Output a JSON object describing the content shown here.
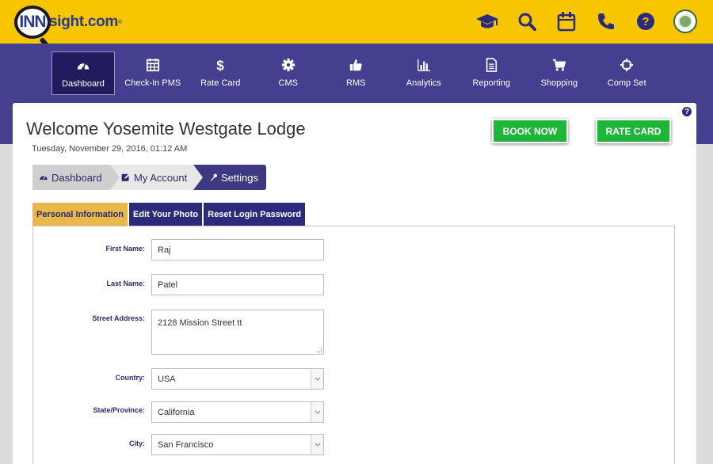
{
  "header": {
    "logo_inn": "INN",
    "logo_text": "sight.com",
    "logo_tm": "®",
    "icons": [
      "graduation-cap-icon",
      "search-icon",
      "calendar-icon",
      "phone-icon",
      "help-icon",
      "avatar"
    ]
  },
  "nav": {
    "items": [
      {
        "label": "Dashboard",
        "icon": "dashboard-icon",
        "active": true
      },
      {
        "label": "Check-In PMS",
        "icon": "calendar-grid-icon"
      },
      {
        "label": "Rate Card",
        "icon": "dollar-icon"
      },
      {
        "label": "CMS",
        "icon": "gear-icon"
      },
      {
        "label": "RMS",
        "icon": "thumbs-up-icon"
      },
      {
        "label": "Analytics",
        "icon": "bar-chart-icon"
      },
      {
        "label": "Reporting",
        "icon": "document-icon"
      },
      {
        "label": "Shopping",
        "icon": "cart-icon"
      },
      {
        "label": "Comp Set",
        "icon": "crosshair-icon"
      }
    ]
  },
  "page": {
    "help_badge": "?",
    "welcome": "Welcome Yosemite Westgate Lodge",
    "datetime": "Tuesday, November 29, 2016, 01:12 AM",
    "book_now": "BOOK NOW",
    "rate_card": "RATE CARD"
  },
  "breadcrumb": {
    "items": [
      {
        "label": "Dashboard",
        "icon": "dashboard-icon"
      },
      {
        "label": "My Account",
        "icon": "edit-icon"
      },
      {
        "label": "Settings",
        "icon": "wrench-icon"
      }
    ]
  },
  "tabs": {
    "items": [
      {
        "label": "Personal Information",
        "active": true
      },
      {
        "label": "Edit Your Photo"
      },
      {
        "label": "Reset Login Password"
      }
    ]
  },
  "form": {
    "first_name_label": "First Name:",
    "first_name": "Raj",
    "last_name_label": "Last Name:",
    "last_name": "Patel",
    "street_label": "Street Address:",
    "street": "2128 Mission Street tt",
    "country_label": "Country:",
    "country": "USA",
    "state_label": "State/Province:",
    "state": "California",
    "city_label": "City:",
    "city": "San Francisco"
  },
  "colors": {
    "topbar": "#f7c600",
    "navbar": "#443f8e",
    "nav_active": "#211c5e",
    "green_button": "#1fb43a",
    "tab_active": "#e8b84a",
    "tab": "#2c2a7a"
  }
}
